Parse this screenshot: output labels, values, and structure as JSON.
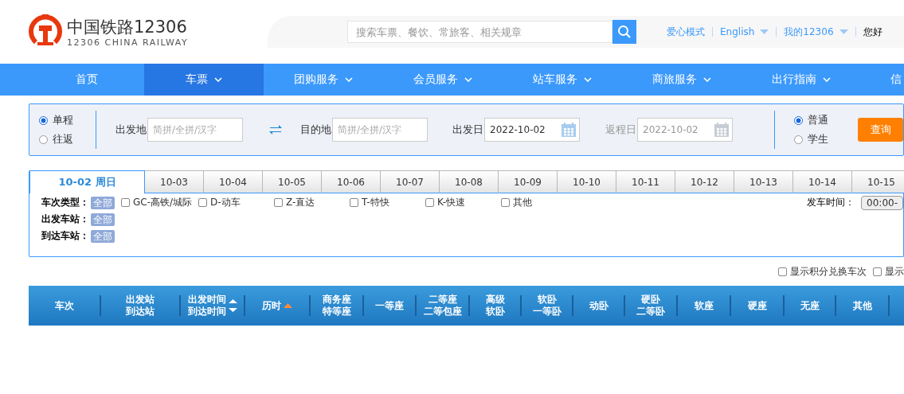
{
  "header": {
    "logo_title": "中国铁路12306",
    "logo_subtitle": "12306 CHINA RAILWAY",
    "search_placeholder": "搜索车票、餐饮、常旅客、相关规章",
    "links": [
      {
        "label": "爱心模式",
        "dropdown": false
      },
      {
        "label": "English",
        "dropdown": true
      },
      {
        "label": "我的12306",
        "dropdown": true
      }
    ],
    "greeting": "您好"
  },
  "nav": [
    {
      "label": "首页",
      "dropdown": false,
      "selected": false
    },
    {
      "label": "车票",
      "dropdown": true,
      "selected": true
    },
    {
      "label": "团购服务",
      "dropdown": true,
      "selected": false
    },
    {
      "label": "会员服务",
      "dropdown": true,
      "selected": false
    },
    {
      "label": "站车服务",
      "dropdown": true,
      "selected": false
    },
    {
      "label": "商旅服务",
      "dropdown": true,
      "selected": false
    },
    {
      "label": "出行指南",
      "dropdown": true,
      "selected": false
    },
    {
      "label": "信",
      "selected": false
    }
  ],
  "query": {
    "trip_types": [
      {
        "label": "单程",
        "selected": true
      },
      {
        "label": "往返",
        "selected": false
      }
    ],
    "from": {
      "label": "出发地",
      "placeholder": "简拼/全拼/汉字"
    },
    "to": {
      "label": "目的地",
      "placeholder": "简拼/全拼/汉字"
    },
    "depart_date": {
      "label": "出发日",
      "value": "2022-10-02",
      "disabled": false
    },
    "return_date": {
      "label": "返程日",
      "value": "2022-10-02",
      "disabled": true
    },
    "passenger_types": [
      {
        "label": "普通",
        "selected": true
      },
      {
        "label": "学生",
        "selected": false
      }
    ],
    "search_button": "查询"
  },
  "dates": [
    {
      "label": "10-02 周日",
      "selected": true
    },
    {
      "label": "10-03",
      "selected": false
    },
    {
      "label": "10-04",
      "selected": false
    },
    {
      "label": "10-05",
      "selected": false
    },
    {
      "label": "10-06",
      "selected": false
    },
    {
      "label": "10-07",
      "selected": false
    },
    {
      "label": "10-08",
      "selected": false
    },
    {
      "label": "10-09",
      "selected": false
    },
    {
      "label": "10-10",
      "selected": false
    },
    {
      "label": "10-11",
      "selected": false
    },
    {
      "label": "10-12",
      "selected": false
    },
    {
      "label": "10-13",
      "selected": false
    },
    {
      "label": "10-14",
      "selected": false
    },
    {
      "label": "10-15",
      "selected": false
    }
  ],
  "filters": {
    "train_type_label": "车次类型：",
    "train_type_all": "全部",
    "train_types": [
      {
        "label": "GC-高铁/城际",
        "checked": false
      },
      {
        "label": "D-动车",
        "checked": false
      },
      {
        "label": "Z-直达",
        "checked": false
      },
      {
        "label": "T-特快",
        "checked": false
      },
      {
        "label": "K-快速",
        "checked": false
      },
      {
        "label": "其他",
        "checked": false
      }
    ],
    "depart_station_label": "出发车站：",
    "depart_station_all": "全部",
    "arrive_station_label": "到达车站：",
    "arrive_station_all": "全部",
    "depart_time_label": "发车时间：",
    "depart_time_value": "00:00-"
  },
  "options": [
    {
      "label": "显示积分兑换车次",
      "checked": false
    },
    {
      "label": "显示",
      "checked": false
    }
  ],
  "table": {
    "columns": [
      {
        "lines": [
          "车次"
        ],
        "kind": "plain"
      },
      {
        "lines": [
          "出发站",
          "到达站"
        ],
        "kind": "plain"
      },
      {
        "lines": [
          "出发时间",
          "到达时间"
        ],
        "kind": "sortable"
      },
      {
        "lines": [
          "历时"
        ],
        "kind": "sorted"
      },
      {
        "lines": [
          "商务座",
          "特等座"
        ],
        "kind": "plain"
      },
      {
        "lines": [
          "一等座"
        ],
        "kind": "plain"
      },
      {
        "lines": [
          "二等座",
          "二等包座"
        ],
        "kind": "plain"
      },
      {
        "lines": [
          "高级",
          "软卧"
        ],
        "kind": "plain"
      },
      {
        "lines": [
          "软卧",
          "一等卧"
        ],
        "kind": "plain"
      },
      {
        "lines": [
          "动卧"
        ],
        "kind": "plain"
      },
      {
        "lines": [
          "硬卧",
          "二等卧"
        ],
        "kind": "plain"
      },
      {
        "lines": [
          "软座"
        ],
        "kind": "plain"
      },
      {
        "lines": [
          "硬座"
        ],
        "kind": "plain"
      },
      {
        "lines": [
          "无座"
        ],
        "kind": "plain"
      },
      {
        "lines": [
          "其他"
        ],
        "kind": "plain"
      }
    ]
  }
}
